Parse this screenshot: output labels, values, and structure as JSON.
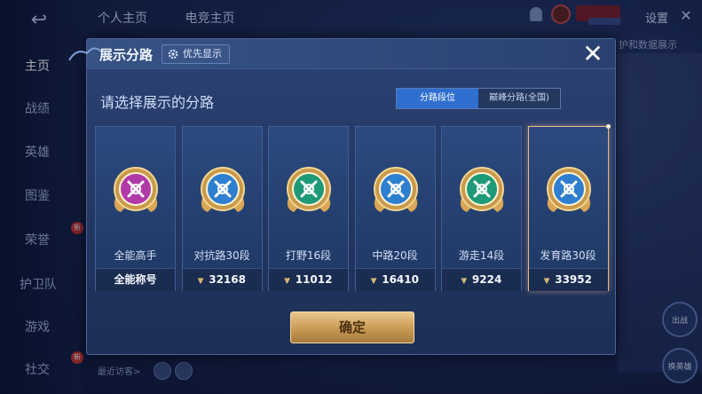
{
  "background": {
    "sidebar": {
      "items": [
        {
          "label": "主页",
          "active": true
        },
        {
          "label": "战绩"
        },
        {
          "label": "英雄"
        },
        {
          "label": "图鉴"
        },
        {
          "label": "荣誉",
          "badge": "新"
        },
        {
          "label": "护卫队"
        },
        {
          "label": "游戏"
        },
        {
          "label": "社交",
          "badge": "新"
        }
      ]
    },
    "top_tabs": [
      "个人主页",
      "电竞主页"
    ],
    "settings_label": "设置",
    "right_text": "护和数据展示",
    "recent_visitors": "最近访客>",
    "right_buttons": [
      "出战",
      "换英雄"
    ]
  },
  "modal": {
    "title": "展示分路",
    "priority_badge": "优先显示",
    "close_symbol": "✕",
    "prompt": "请选择展示的分路",
    "toggle": {
      "options": [
        "分路段位",
        "巅峰分路(全国)"
      ],
      "selected": "分路段位"
    },
    "cards": [
      {
        "name": "全能高手",
        "value": "全能称号",
        "show_chevron": false,
        "emblem_color": "#b23aa8",
        "selected": false
      },
      {
        "name": "对抗路30段",
        "value": "32168",
        "show_chevron": true,
        "emblem_color": "#2e7fd0",
        "selected": false
      },
      {
        "name": "打野16段",
        "value": "11012",
        "show_chevron": true,
        "emblem_color": "#1f9a78",
        "selected": false
      },
      {
        "name": "中路20段",
        "value": "16410",
        "show_chevron": true,
        "emblem_color": "#2e7fd0",
        "selected": false
      },
      {
        "name": "游走14段",
        "value": "9224",
        "show_chevron": true,
        "emblem_color": "#1f9a78",
        "selected": false
      },
      {
        "name": "发育路30段",
        "value": "33952",
        "show_chevron": true,
        "emblem_color": "#2e7fd0",
        "selected": true
      }
    ],
    "confirm_label": "确定"
  }
}
